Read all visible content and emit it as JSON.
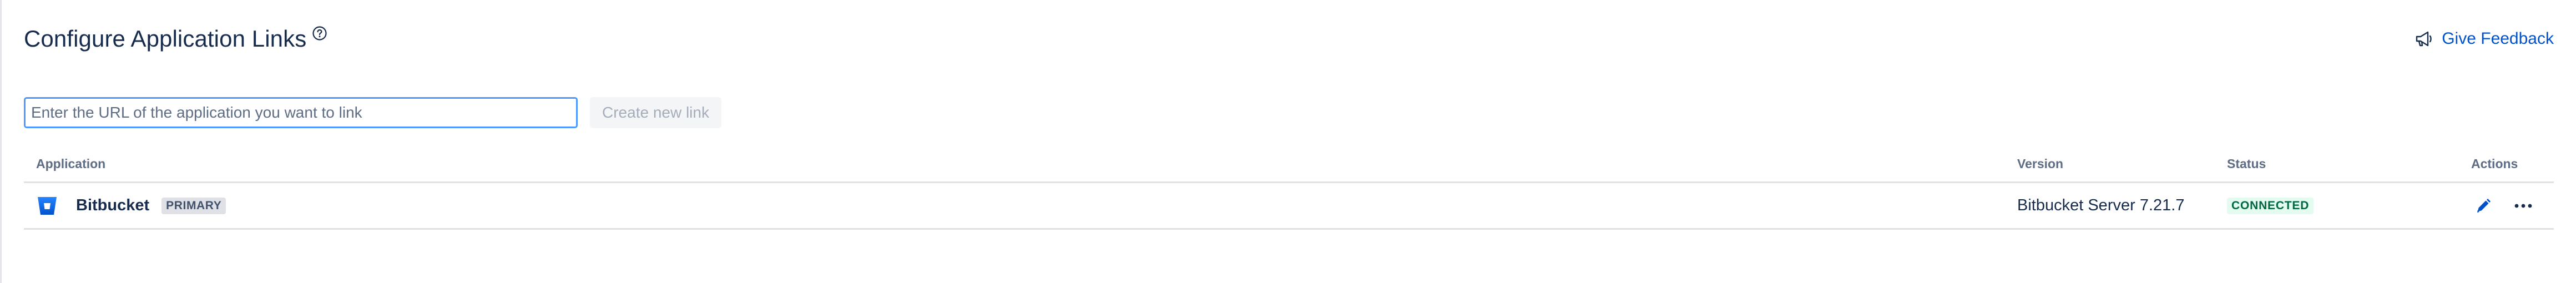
{
  "header": {
    "title": "Configure Application Links",
    "help_icon": "question-circle-icon",
    "feedback_label": "Give Feedback",
    "feedback_icon": "megaphone-icon"
  },
  "toolbar": {
    "url_input_placeholder": "Enter the URL of the application you want to link",
    "url_input_value": "",
    "create_button_label": "Create new link"
  },
  "table": {
    "columns": [
      "Application",
      "Version",
      "Status",
      "Actions"
    ],
    "rows": [
      {
        "icon": "bitbucket-icon",
        "name": "Bitbucket",
        "badge": "PRIMARY",
        "version": "Bitbucket Server 7.21.7",
        "status": "CONNECTED",
        "actions": [
          "edit-icon",
          "more-icon"
        ]
      }
    ]
  },
  "colors": {
    "link_blue": "#0052CC",
    "input_focus_border": "#4C9AFF",
    "bitbucket_blue": "#2684FF",
    "status_success_bg": "#E3FCEF",
    "status_success_text": "#006644",
    "primary_badge_bg": "#DFE1E6",
    "text_primary": "#172B4D",
    "text_subtle": "#5E6C84"
  }
}
